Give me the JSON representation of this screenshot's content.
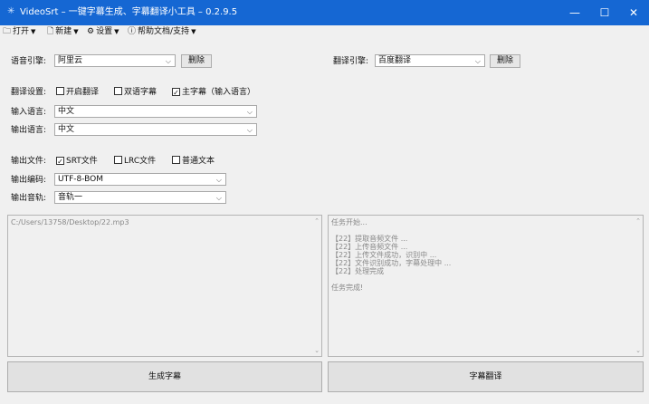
{
  "window": {
    "title": "VideoSrt – 一键字幕生成、字幕翻译小工具 – 0.2.9.5",
    "controls": {
      "minimize": "—",
      "maximize": "☐",
      "close": "✕"
    }
  },
  "menu": {
    "open": "打开",
    "new": "新建",
    "settings": "设置",
    "help": "帮助文档/支持",
    "icons": {
      "open": "folder-icon",
      "new": "file-icon",
      "settings": "gear-icon",
      "help": "info-icon"
    }
  },
  "speech": {
    "label": "语音引擎:",
    "value": "阿里云",
    "delete": "删除"
  },
  "translate": {
    "label": "翻译引擎:",
    "value": "百度翻译",
    "delete": "删除"
  },
  "settings": {
    "label": "翻译设置:",
    "enable_translate": {
      "label": "开启翻译",
      "checked": false
    },
    "bilingual": {
      "label": "双语字幕",
      "checked": false
    },
    "main_subtitle": {
      "label": "主字幕（输入语言）",
      "checked": true
    }
  },
  "input_lang": {
    "label": "输入语言:",
    "value": "中文"
  },
  "output_lang": {
    "label": "输出语言:",
    "value": "中文"
  },
  "output_files": {
    "label": "输出文件:",
    "srt": {
      "label": "SRT文件",
      "checked": true
    },
    "lrc": {
      "label": "LRC文件",
      "checked": false
    },
    "txt": {
      "label": "普通文本",
      "checked": false
    }
  },
  "encoding": {
    "label": "输出编码:",
    "value": "UTF-8-BOM"
  },
  "track": {
    "label": "输出音轨:",
    "value": "音轨一"
  },
  "left_panel": {
    "text": "C:/Users/13758/Desktop/22.mp3"
  },
  "log_panel": {
    "text": "任务开始...\n\n【22】提取音频文件 ...\n【22】上传音频文件 ...\n【22】上传文件成功，识别中 ...\n【22】文件识别成功，字幕处理中 ...\n【22】处理完成\n\n任务完成!"
  },
  "actions": {
    "generate": "生成字幕",
    "translate": "字幕翻译"
  }
}
